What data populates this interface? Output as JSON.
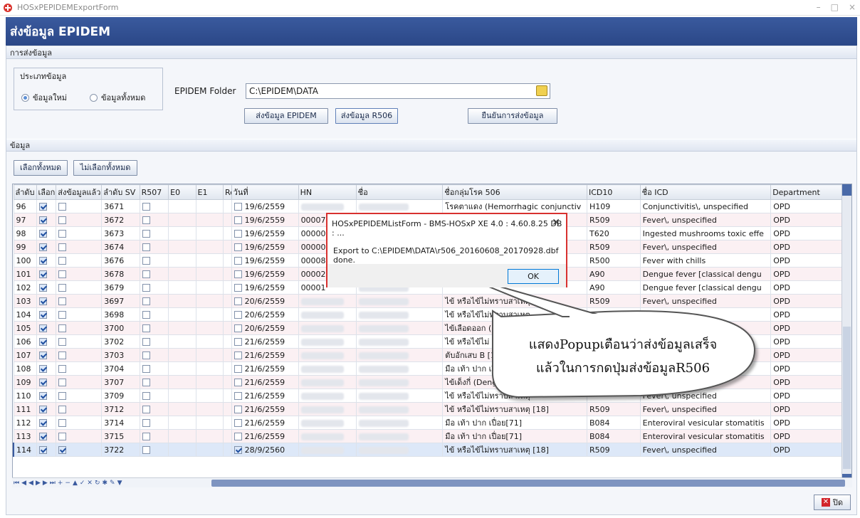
{
  "window": {
    "title": "HOSxPEPIDEMExportForm",
    "controls": [
      "–",
      "□",
      "×"
    ]
  },
  "header": {
    "title": "ส่งข้อมูล EPIDEM"
  },
  "send_section": {
    "title": "การส่งข้อมูล"
  },
  "data_type": {
    "legend": "ประเภทข้อมูล",
    "options": [
      {
        "label": "ข้อมูลใหม่",
        "selected": true
      },
      {
        "label": "ข้อมูลทั้งหมด",
        "selected": false
      }
    ]
  },
  "folder": {
    "label": "EPIDEM Folder",
    "value": "C:\\EPIDEM\\DATA"
  },
  "buttons": {
    "send_epidem": "ส่งข้อมูล EPIDEM",
    "send_r506": "ส่งข้อมูล R506",
    "confirm": "ยืนยันการส่งข้อมูล",
    "select_all": "เลือกทั้งหมด",
    "deselect_all": "ไม่เลือกทั้งหมด",
    "close": "ปิด"
  },
  "data_section": {
    "title": "ข้อมูล"
  },
  "grid": {
    "columns": [
      "ลำดับ",
      "เลือก",
      "ส่งข้อมูลแล้ว",
      "ลำดับ SV",
      "R507",
      "E0",
      "E1",
      "Re",
      "วันที่",
      "HN",
      "ชื่อ",
      "ชื่อกลุ่มโรค 506",
      "ICD10",
      "ชื่อ ICD",
      "Department"
    ],
    "rows": [
      {
        "no": "96",
        "sel": true,
        "sent": false,
        "sv": "3671",
        "re": false,
        "date": "19/6/2559",
        "hn": "",
        "group": "โรคตาแดง (Hemorrhagic conjunctiv",
        "icd": "H109",
        "icdname": "Conjunctivitis\\, unspecified",
        "dept": "OPD"
      },
      {
        "no": "97",
        "sel": true,
        "sent": false,
        "sv": "3672",
        "re": false,
        "date": "19/6/2559",
        "hn": "00007",
        "group": "",
        "icd": "R509",
        "icdname": "Fever\\, unspecified",
        "dept": "OPD"
      },
      {
        "no": "98",
        "sel": true,
        "sent": false,
        "sv": "3673",
        "re": false,
        "date": "19/6/2559",
        "hn": "00000",
        "group": "",
        "icd": "T620",
        "icdname": "Ingested mushrooms toxic effe",
        "dept": "OPD"
      },
      {
        "no": "99",
        "sel": true,
        "sent": false,
        "sv": "3674",
        "re": false,
        "date": "19/6/2559",
        "hn": "00000",
        "group": "",
        "icd": "R509",
        "icdname": "Fever\\, unspecified",
        "dept": "OPD"
      },
      {
        "no": "100",
        "sel": true,
        "sent": false,
        "sv": "3676",
        "re": false,
        "date": "19/6/2559",
        "hn": "00008",
        "group": "",
        "icd": "R500",
        "icdname": "Fever with chills",
        "dept": "OPD"
      },
      {
        "no": "101",
        "sel": true,
        "sent": false,
        "sv": "3678",
        "re": false,
        "date": "19/6/2559",
        "hn": "00002",
        "group": "",
        "icd": "A90",
        "icdname": "Dengue fever [classical dengu",
        "dept": "OPD"
      },
      {
        "no": "102",
        "sel": true,
        "sent": false,
        "sv": "3679",
        "re": false,
        "date": "19/6/2559",
        "hn": "00001",
        "group": "",
        "icd": "A90",
        "icdname": "Dengue fever [classical dengu",
        "dept": "OPD"
      },
      {
        "no": "103",
        "sel": true,
        "sent": false,
        "sv": "3697",
        "re": false,
        "date": "20/6/2559",
        "hn": "",
        "group": "ไข้ หรือไข้ไม่ทราบสาเหตุ",
        "icd": "R509",
        "icdname": "Fever\\, unspecified",
        "dept": "OPD"
      },
      {
        "no": "104",
        "sel": true,
        "sent": false,
        "sv": "3698",
        "re": false,
        "date": "20/6/2559",
        "hn": "",
        "group": "ไข้ หรือไข้ไม่ทราบสาเหตุ",
        "icd": "",
        "icdname": "",
        "dept": "OPD"
      },
      {
        "no": "105",
        "sel": true,
        "sent": false,
        "sv": "3700",
        "re": false,
        "date": "20/6/2559",
        "hn": "",
        "group": "ไข้เลือดออก (D",
        "icd": "",
        "icdname": "",
        "dept": "OPD"
      },
      {
        "no": "106",
        "sel": true,
        "sent": false,
        "sv": "3702",
        "re": false,
        "date": "21/6/2559",
        "hn": "",
        "group": "ไข้ หรือไข้ไม่",
        "icd": "",
        "icdname": "",
        "dept": "OPD"
      },
      {
        "no": "107",
        "sel": true,
        "sent": false,
        "sv": "3703",
        "re": false,
        "date": "21/6/2559",
        "hn": "",
        "group": "ตับอักเสบ B [1",
        "icd": "",
        "icdname": "",
        "dept": "OPD"
      },
      {
        "no": "108",
        "sel": true,
        "sent": false,
        "sv": "3704",
        "re": false,
        "date": "21/6/2559",
        "hn": "",
        "group": "มือ เท้า ปาก เปื่",
        "icd": "",
        "icdname": "",
        "dept": "OPD"
      },
      {
        "no": "109",
        "sel": true,
        "sent": false,
        "sv": "3707",
        "re": false,
        "date": "21/6/2559",
        "hn": "",
        "group": "ไข้เด็งกี่ (Deng",
        "icd": "",
        "icdname": "",
        "dept": "OPD"
      },
      {
        "no": "110",
        "sel": true,
        "sent": false,
        "sv": "3709",
        "re": false,
        "date": "21/6/2559",
        "hn": "",
        "group": "ไข้ หรือไข้ไม่ทราบสาเหตุ",
        "icd": "",
        "icdname": "Fever\\, unspecified",
        "dept": "OPD"
      },
      {
        "no": "111",
        "sel": true,
        "sent": false,
        "sv": "3712",
        "re": false,
        "date": "21/6/2559",
        "hn": "",
        "group": "ไข้ หรือไข้ไม่ทราบสาเหตุ [18]",
        "icd": "R509",
        "icdname": "Fever\\, unspecified",
        "dept": "OPD"
      },
      {
        "no": "112",
        "sel": true,
        "sent": false,
        "sv": "3714",
        "re": false,
        "date": "21/6/2559",
        "hn": "",
        "group": "มือ เท้า ปาก เปื่อย[71]",
        "icd": "B084",
        "icdname": "Enteroviral vesicular stomatitis",
        "dept": "OPD"
      },
      {
        "no": "113",
        "sel": true,
        "sent": false,
        "sv": "3715",
        "re": false,
        "date": "21/6/2559",
        "hn": "",
        "group": "มือ เท้า ปาก เปื่อย[71]",
        "icd": "B084",
        "icdname": "Enteroviral vesicular stomatitis",
        "dept": "OPD"
      },
      {
        "no": "114",
        "sel": true,
        "sent": true,
        "sv": "3722",
        "re": true,
        "date": "28/9/2560",
        "hn": "",
        "group": "ไข้ หรือไข้ไม่ทราบสาเหตุ [18]",
        "icd": "R509",
        "icdname": "Fever\\, unspecified",
        "dept": "OPD",
        "current": true
      }
    ]
  },
  "dialog": {
    "title": "HOSxPEPIDEMListForm - BMS-HOSxP XE 4.0 : 4.60.8.25 DB : ...",
    "message": "Export to C:\\EPIDEM\\DATA\\r506_20160608_20170928.dbf done.",
    "ok": "OK"
  },
  "callout": {
    "line1": "แสดงPopupเตือนว่าส่งข้อมูลเสร็จ",
    "line2": "แล้วในการกดปุ่มส่งข้อมูลR506"
  },
  "colors": {
    "header": "#2f4d8e",
    "dialog_border": "#d8312f",
    "alt_row": "#fbf0f3"
  }
}
